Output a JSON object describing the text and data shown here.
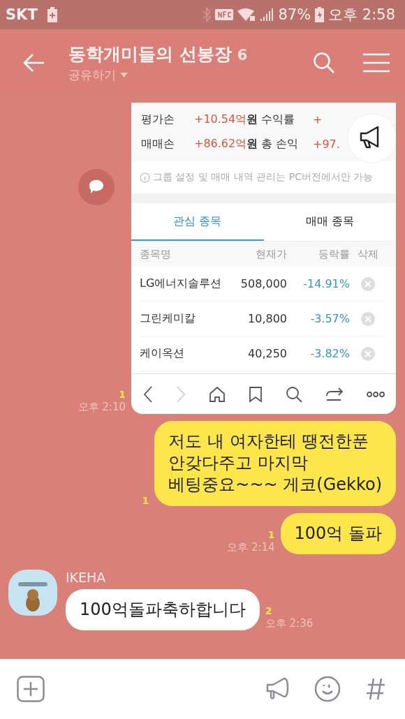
{
  "status_bar": {
    "carrier": "SKT",
    "battery": "87%",
    "time": "오후 2:58"
  },
  "header": {
    "title": "동학개미들의 선봉장",
    "member_count": "6",
    "subtitle": "공유하기"
  },
  "shot": {
    "summary": [
      {
        "label": "평가손",
        "value": "+10.54억**원**",
        "label2": "수익률",
        "value2": "+"
      },
      {
        "label": "매매손",
        "value": "+86.62억**원**",
        "label2": "총 손익",
        "value2": "+97."
      }
    ],
    "notice": "그룹 설정 및 매매 내역 관리는 PC버전에서만 가능",
    "tabs": [
      {
        "label": "관심 종목",
        "selected": true
      },
      {
        "label": "매매 종목",
        "selected": false
      }
    ],
    "columns": [
      "종목명",
      "현재가",
      "등락률",
      "삭제"
    ],
    "rows": [
      {
        "name": "LG에너지솔루션",
        "price": "508,000",
        "change": "-14.91%"
      },
      {
        "name": "그린케미칼",
        "price": "10,800",
        "change": "-3.57%"
      },
      {
        "name": "케이옥션",
        "price": "40,250",
        "change": "-3.82%"
      }
    ]
  },
  "messages": [
    {
      "unread": "1",
      "time": "오후 2:10"
    },
    {
      "kind": "sent",
      "text": "저도 내 여자한테 땡전한푼\n안갖다주고 마지막\n베팅중요~~~ 게코(Gekko)",
      "unread": "1"
    },
    {
      "kind": "sent",
      "text": "100억 돌파",
      "unread": "1",
      "time": "오후 2:14"
    },
    {
      "kind": "received",
      "sender": "IKEHA",
      "text": "100억돌파축하합니다",
      "unread": "2",
      "time": "오후 2:36"
    }
  ]
}
